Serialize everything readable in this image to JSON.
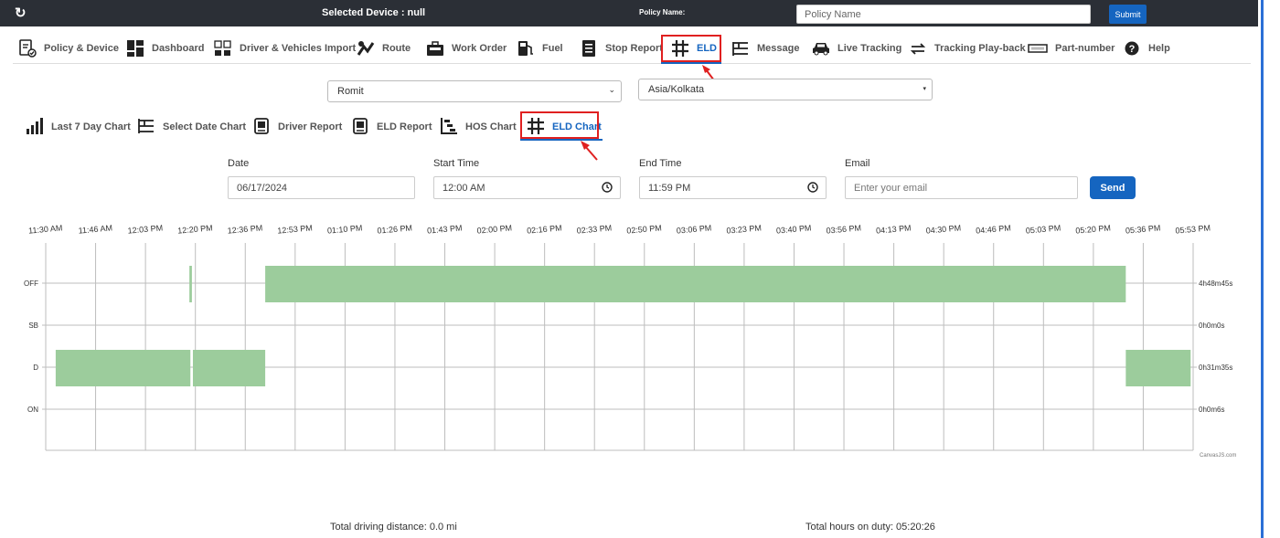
{
  "topbar": {
    "selected_device": "Selected Device : null",
    "policy_name_label": "Policy Name:",
    "policy_name_placeholder": "Policy Name",
    "submit_label": "Submit"
  },
  "main_nav": [
    {
      "label": "Policy & Device",
      "icon": "policy-device-icon"
    },
    {
      "label": "Dashboard",
      "icon": "dashboard-icon"
    },
    {
      "label": "Driver & Vehicles Import",
      "icon": "import-icon"
    },
    {
      "label": "Route",
      "icon": "route-icon"
    },
    {
      "label": "Work Order",
      "icon": "work-order-icon"
    },
    {
      "label": "Fuel",
      "icon": "fuel-icon"
    },
    {
      "label": "Stop Report",
      "icon": "report-icon"
    },
    {
      "label": "ELD",
      "icon": "eld-grid-icon",
      "active": true
    },
    {
      "label": "Message",
      "icon": "message-icon"
    },
    {
      "label": "Live Tracking",
      "icon": "car-icon"
    },
    {
      "label": "Tracking Play-back",
      "icon": "playback-icon"
    },
    {
      "label": "Part-number",
      "icon": "part-number-icon"
    },
    {
      "label": "Help",
      "icon": "help-icon"
    }
  ],
  "driver_select": {
    "value": "Romit"
  },
  "timezone_select": {
    "value": "Asia/Kolkata"
  },
  "sub_nav": [
    {
      "label": "Last 7 Day Chart",
      "icon": "bar-chart-icon"
    },
    {
      "label": "Select Date Chart",
      "icon": "list-icon"
    },
    {
      "label": "Driver Report",
      "icon": "document-icon"
    },
    {
      "label": "ELD Report",
      "icon": "document-icon"
    },
    {
      "label": "HOS Chart",
      "icon": "hos-chart-icon"
    },
    {
      "label": "ELD Chart",
      "icon": "eld-grid-icon",
      "active": true
    }
  ],
  "form": {
    "date_label": "Date",
    "date_value": "06/17/2024",
    "start_label": "Start Time",
    "start_value": "12:00 AM",
    "end_label": "End Time",
    "end_value": "11:59 PM",
    "email_label": "Email",
    "email_placeholder": "Enter your email",
    "send_label": "Send"
  },
  "chart_data": {
    "type": "timeline",
    "x_ticks": [
      "11:30 AM",
      "11:46 AM",
      "12:03 PM",
      "12:20 PM",
      "12:36 PM",
      "12:53 PM",
      "01:10 PM",
      "01:26 PM",
      "01:43 PM",
      "02:00 PM",
      "02:16 PM",
      "02:33 PM",
      "02:50 PM",
      "03:06 PM",
      "03:23 PM",
      "03:40 PM",
      "03:56 PM",
      "04:13 PM",
      "04:30 PM",
      "04:46 PM",
      "05:03 PM",
      "05:20 PM",
      "05:36 PM",
      "05:53 PM"
    ],
    "rows": [
      "OFF",
      "SB",
      "D",
      "ON"
    ],
    "row_totals": [
      "4h48m45s",
      "0h0m0s",
      "0h31m35s",
      "0h0m6s"
    ],
    "segments": [
      {
        "row": "D",
        "start": 0.2,
        "end": 2.9
      },
      {
        "row": "OFF",
        "start": 2.88,
        "end": 2.93
      },
      {
        "row": "D",
        "start": 2.95,
        "end": 4.4
      },
      {
        "row": "OFF",
        "start": 4.4,
        "end": 21.65
      },
      {
        "row": "D",
        "start": 21.65,
        "end": 22.95
      }
    ],
    "bar_color": "#9ccc9c",
    "credit": "CanvasJS.com"
  },
  "footer": {
    "distance": "Total driving distance: 0.0 mi",
    "hours": "Total hours on duty: 05:20:26"
  }
}
